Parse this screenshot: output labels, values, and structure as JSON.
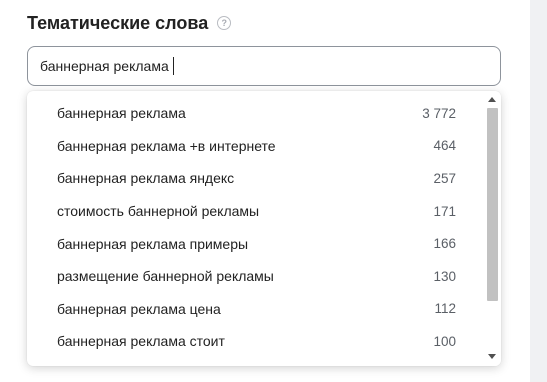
{
  "section": {
    "title": "Тематические слова",
    "help_icon": "?"
  },
  "search": {
    "value": "баннерная реклама"
  },
  "suggestions": [
    {
      "label": "баннерная реклама",
      "count": "3 772"
    },
    {
      "label": "баннерная реклама +в интернете",
      "count": "464"
    },
    {
      "label": "баннерная реклама яндекс",
      "count": "257"
    },
    {
      "label": "стоимость баннерной рекламы",
      "count": "171"
    },
    {
      "label": "баннерная реклама примеры",
      "count": "166"
    },
    {
      "label": "размещение баннерной рекламы",
      "count": "130"
    },
    {
      "label": "баннерная реклама цена",
      "count": "112"
    },
    {
      "label": "баннерная реклама стоит",
      "count": "100"
    }
  ]
}
